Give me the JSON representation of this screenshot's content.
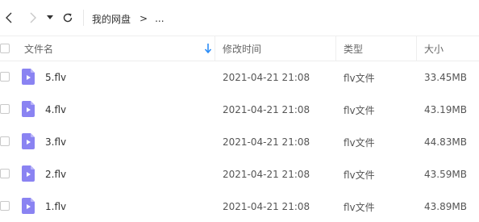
{
  "breadcrumb": {
    "root": "我的网盘",
    "separator": ">",
    "ellipsis": "..."
  },
  "table": {
    "headers": {
      "name": "文件名",
      "modified": "修改时间",
      "type": "类型",
      "size": "大小"
    },
    "sort_indicator": "arrow-down-icon",
    "rows": [
      {
        "name": "5.flv",
        "modified": "2021-04-21 21:08",
        "type": "flv文件",
        "size": "33.45MB"
      },
      {
        "name": "4.flv",
        "modified": "2021-04-21 21:08",
        "type": "flv文件",
        "size": "43.19MB"
      },
      {
        "name": "3.flv",
        "modified": "2021-04-21 21:08",
        "type": "flv文件",
        "size": "44.83MB"
      },
      {
        "name": "2.flv",
        "modified": "2021-04-21 21:08",
        "type": "flv文件",
        "size": "43.59MB"
      },
      {
        "name": "1.flv",
        "modified": "2021-04-21 21:08",
        "type": "flv文件",
        "size": "43.89MB"
      }
    ]
  },
  "colors": {
    "accent": "#2b8cf7",
    "video_icon": "#8a83f2",
    "video_icon_fold": "#b9b4f8"
  }
}
